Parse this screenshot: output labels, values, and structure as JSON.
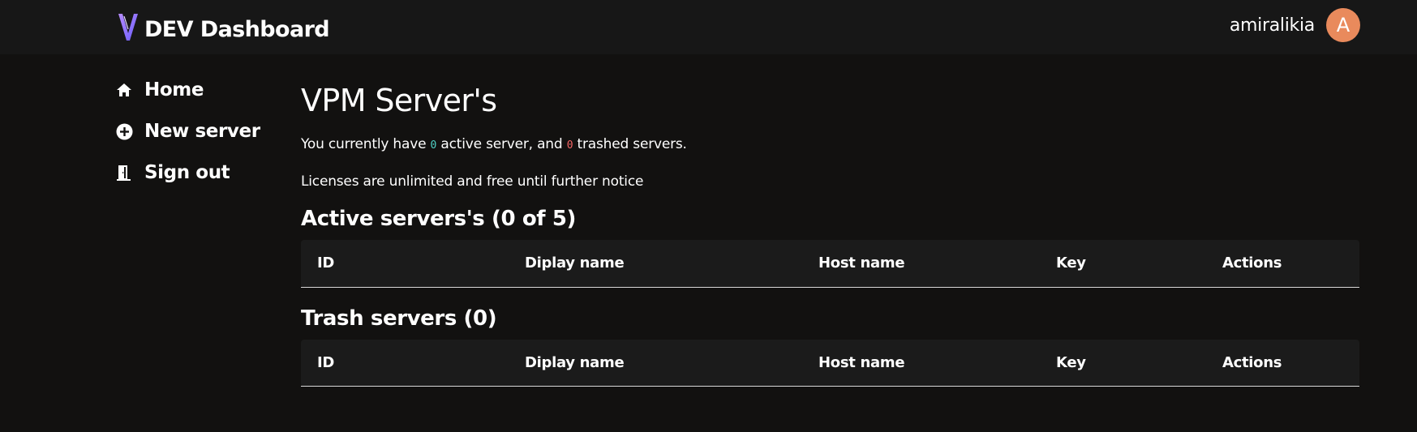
{
  "header": {
    "brand_title": "DEV Dashboard",
    "logo_icon": "v-logo-icon",
    "username": "amiralikia",
    "avatar_initial": "A",
    "avatar_color": "#e98a5c"
  },
  "sidebar": {
    "items": [
      {
        "label": "Home",
        "icon": "home-icon"
      },
      {
        "label": "New server",
        "icon": "plus-circle-icon"
      },
      {
        "label": "Sign out",
        "icon": "door-icon"
      }
    ]
  },
  "main": {
    "title": "VPM Server's",
    "summary": {
      "prefix": "You currently have ",
      "active_count": "0",
      "middle": " active server, and ",
      "trash_count": "0",
      "suffix": " trashed servers.",
      "active_color": "#4fd1c5",
      "trash_color": "#f56565"
    },
    "license_note": "Licenses are unlimited and free until further notice",
    "active_section": {
      "title": "Active servers's (0 of 5)",
      "columns": [
        "ID",
        "Diplay name",
        "Host name",
        "Key",
        "Actions"
      ]
    },
    "trash_section": {
      "title": "Trash servers (0)",
      "columns": [
        "ID",
        "Diplay name",
        "Host name",
        "Key",
        "Actions"
      ]
    }
  }
}
